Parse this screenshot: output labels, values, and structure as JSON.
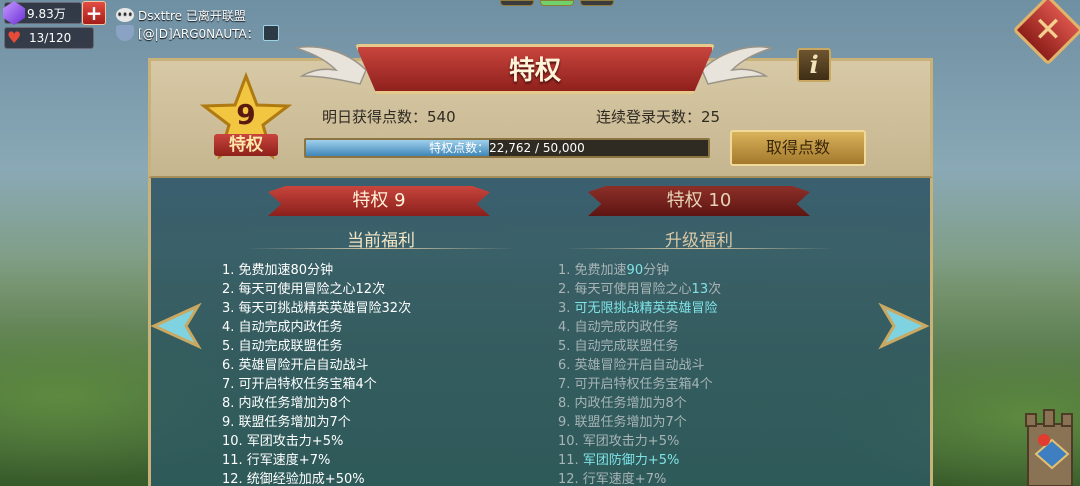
{
  "resources": {
    "gems": "9.83万",
    "stamina": "13/120"
  },
  "chat": {
    "line1": "Dsxttre 已离开联盟",
    "line2": "[@|D]ARG0NAUTA："
  },
  "panel": {
    "title": "特权",
    "vip_level": "9",
    "vip_label": "特权",
    "tomorrow_points_label": "明日获得点数：540",
    "login_days_label": "连续登录天数：25",
    "progress_text": "特权点数：22,762 / 50,000",
    "progress_fraction": 0.455,
    "get_points_button": "取得点数"
  },
  "current": {
    "banner": "特权 9",
    "heading": "当前福利",
    "items": [
      "1. 免费加速80分钟",
      "2. 每天可使用冒险之心12次",
      "3. 每天可挑战精英英雄冒险32次",
      "4. 自动完成内政任务",
      "5. 自动完成联盟任务",
      "6. 英雄冒险开启自动战斗",
      "7. 可开启特权任务宝箱4个",
      "8. 内政任务增加为8个",
      "9. 联盟任务增加为7个",
      "10. 军团攻击力+5%",
      "11. 行军速度+7%",
      "12. 统御经验加成+50%"
    ]
  },
  "next": {
    "banner": "特权 10",
    "heading": "升级福利",
    "items": [
      {
        "pre": "1. 免费加速",
        "hl": "90",
        "post": "分钟"
      },
      {
        "pre": "2. 每天可使用冒险之心",
        "hl": "13",
        "post": "次"
      },
      {
        "pre": "3. ",
        "hl": "可无限挑战精英英雄冒险",
        "post": ""
      },
      {
        "pre": "4. 自动完成内政任务",
        "hl": "",
        "post": ""
      },
      {
        "pre": "5. 自动完成联盟任务",
        "hl": "",
        "post": ""
      },
      {
        "pre": "6. 英雄冒险开启自动战斗",
        "hl": "",
        "post": ""
      },
      {
        "pre": "7. 可开启特权任务宝箱4个",
        "hl": "",
        "post": ""
      },
      {
        "pre": "8. 内政任务增加为8个",
        "hl": "",
        "post": ""
      },
      {
        "pre": "9. 联盟任务增加为7个",
        "hl": "",
        "post": ""
      },
      {
        "pre": "10. 军团攻击力+5%",
        "hl": "",
        "post": ""
      },
      {
        "pre": "11. ",
        "hl": "军团防御力+5%",
        "post": ""
      },
      {
        "pre": "12. 行军速度+7%",
        "hl": "",
        "post": ""
      }
    ]
  },
  "colors": {
    "accent_red": "#b23a33",
    "gold": "#d9b25b",
    "highlight": "#7fe3e8"
  },
  "icons": [
    "gem-icon",
    "heart-icon",
    "add-icon",
    "chat-icon",
    "alliance-icon",
    "close-icon",
    "info-icon",
    "star-icon",
    "wing-icon",
    "arrow-left-icon",
    "arrow-right-icon",
    "castle-icon"
  ]
}
